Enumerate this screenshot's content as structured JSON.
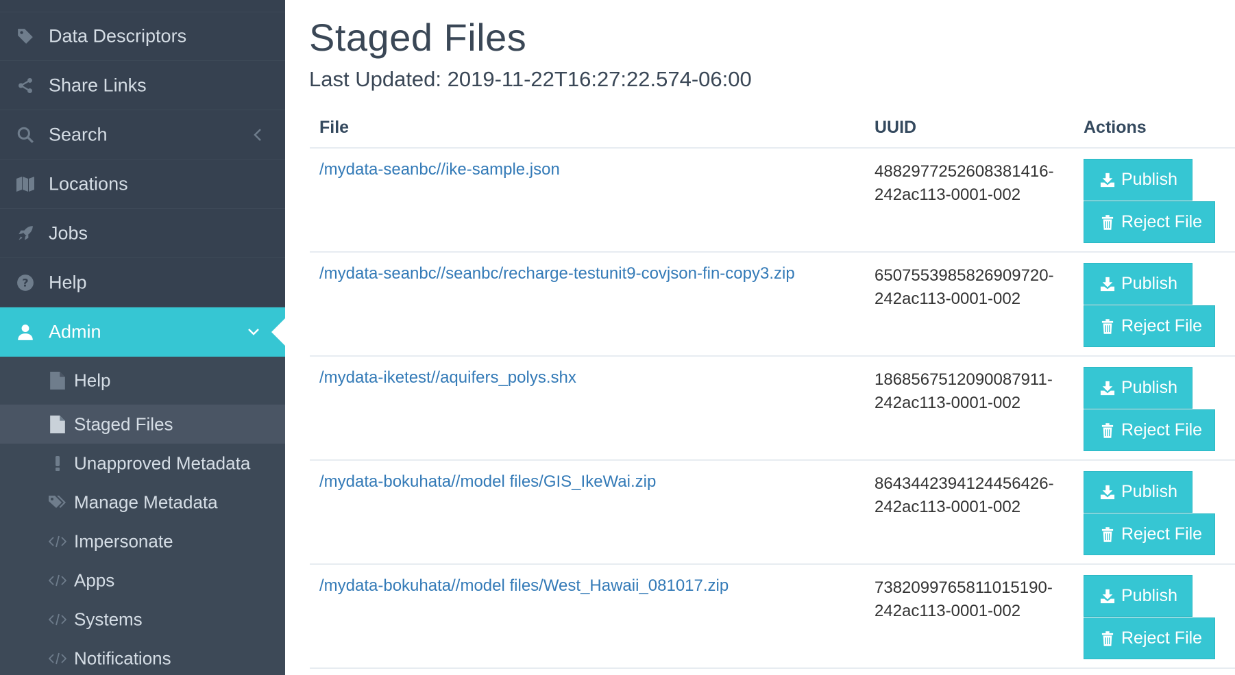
{
  "sidebar": {
    "items": [
      {
        "label": "Data Descriptors",
        "icon": "tag-icon"
      },
      {
        "label": "Share Links",
        "icon": "share-icon"
      },
      {
        "label": "Search",
        "icon": "search-icon"
      },
      {
        "label": "Locations",
        "icon": "map-icon"
      },
      {
        "label": "Jobs",
        "icon": "rocket-icon"
      },
      {
        "label": "Help",
        "icon": "question-circle-icon"
      },
      {
        "label": "Admin",
        "icon": "user-icon"
      }
    ],
    "admin_sub": [
      {
        "label": "Help",
        "icon": "file-icon"
      },
      {
        "label": "Staged Files",
        "icon": "file-icon"
      },
      {
        "label": "Unapproved Metadata",
        "icon": "exclamation-icon"
      },
      {
        "label": "Manage Metadata",
        "icon": "tags-icon"
      },
      {
        "label": "Impersonate",
        "icon": "code-icon"
      },
      {
        "label": "Apps",
        "icon": "code-icon"
      },
      {
        "label": "Systems",
        "icon": "code-icon"
      },
      {
        "label": "Notifications",
        "icon": "code-icon"
      }
    ]
  },
  "colors": {
    "sidebar_bg": "#364150",
    "accent": "#36c6d3",
    "link": "#337ab7"
  },
  "main": {
    "title": "Staged Files",
    "last_updated": "Last Updated: 2019-11-22T16:27:22.574-06:00",
    "table": {
      "headers": {
        "file": "File",
        "uuid": "UUID",
        "actions": "Actions"
      },
      "publish_label": "Publish",
      "reject_label": "Reject File",
      "rows": [
        {
          "file": "/mydata-seanbc//ike-sample.json",
          "uuid1": "4882977252608381416-",
          "uuid2": "242ac113-0001-002"
        },
        {
          "file": "/mydata-seanbc//seanbc/recharge-testunit9-covjson-fin-copy3.zip",
          "uuid1": "6507553985826909720-",
          "uuid2": "242ac113-0001-002"
        },
        {
          "file": "/mydata-iketest//aquifers_polys.shx",
          "uuid1": "1868567512090087911-",
          "uuid2": "242ac113-0001-002"
        },
        {
          "file": "/mydata-bokuhata//model files/GIS_IkeWai.zip",
          "uuid1": "8643442394124456426-",
          "uuid2": "242ac113-0001-002"
        },
        {
          "file": "/mydata-bokuhata//model files/West_Hawaii_081017.zip",
          "uuid1": "7382099765811015190-",
          "uuid2": "242ac113-0001-002"
        }
      ]
    }
  }
}
